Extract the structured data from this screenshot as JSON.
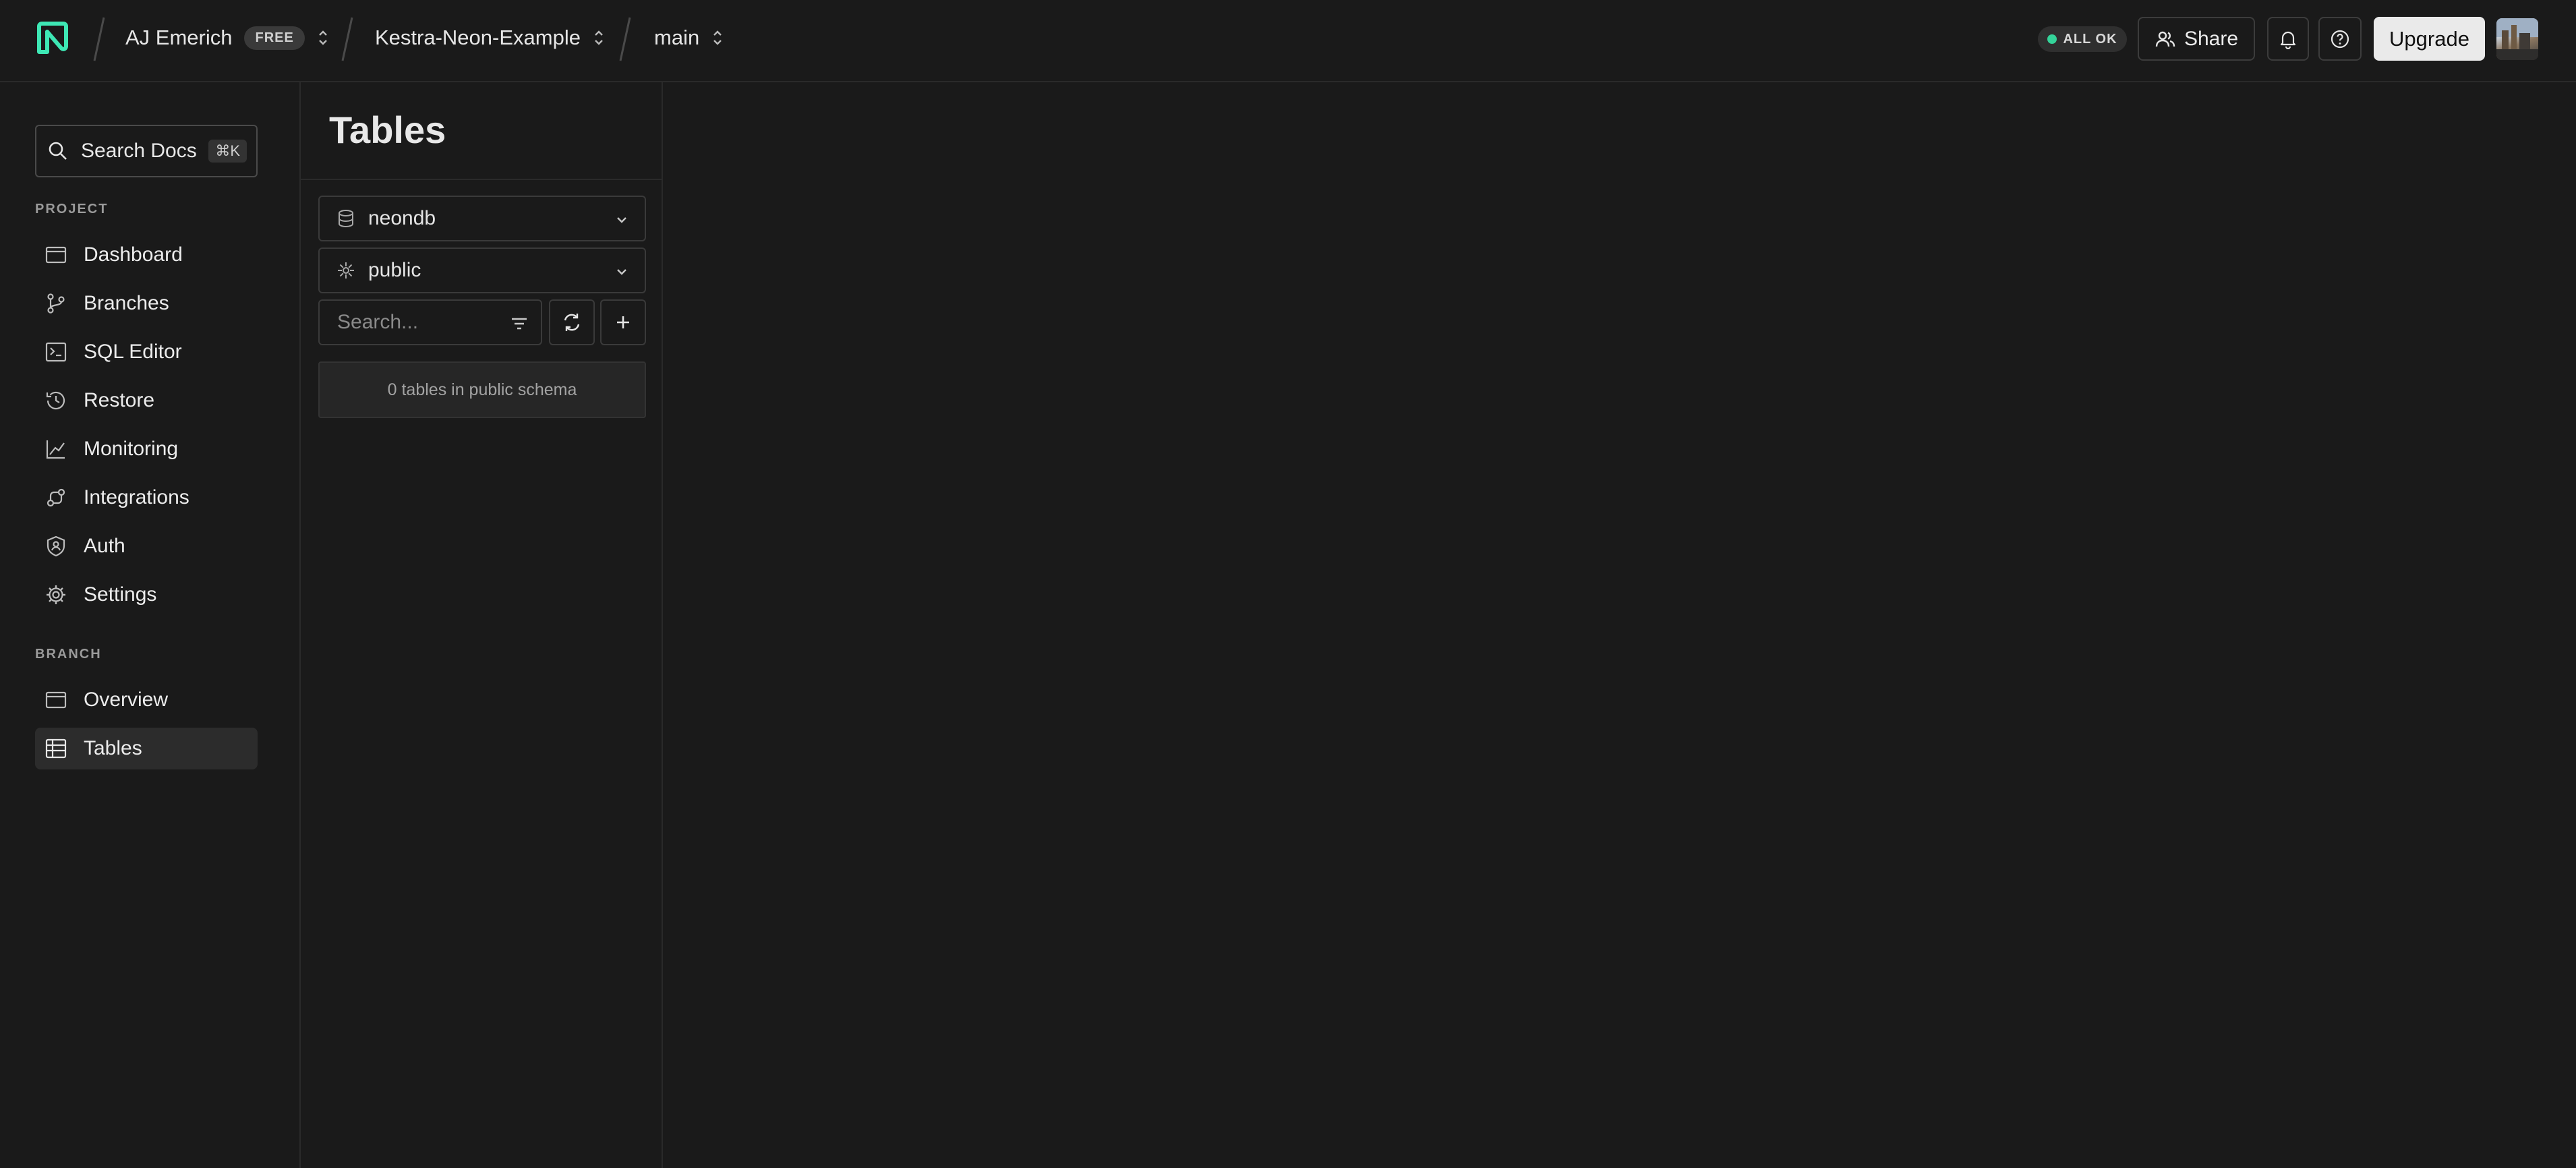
{
  "header": {
    "org_name": "AJ Emerich",
    "plan_badge": "FREE",
    "project_name": "Kestra-Neon-Example",
    "branch_name": "main",
    "status_label": "ALL OK",
    "share_label": "Share",
    "upgrade_label": "Upgrade"
  },
  "sidebar": {
    "search_label": "Search Docs",
    "search_shortcut": "⌘K",
    "project_section": "PROJECT",
    "project_items": [
      {
        "label": "Dashboard",
        "icon": "dashboard-icon"
      },
      {
        "label": "Branches",
        "icon": "branches-icon"
      },
      {
        "label": "SQL Editor",
        "icon": "sql-editor-icon"
      },
      {
        "label": "Restore",
        "icon": "restore-icon"
      },
      {
        "label": "Monitoring",
        "icon": "monitoring-icon"
      },
      {
        "label": "Integrations",
        "icon": "integrations-icon"
      },
      {
        "label": "Auth",
        "icon": "auth-icon"
      },
      {
        "label": "Settings",
        "icon": "gear-icon"
      }
    ],
    "branch_section": "BRANCH",
    "branch_items": [
      {
        "label": "Overview",
        "icon": "overview-icon"
      },
      {
        "label": "Tables",
        "icon": "tables-icon",
        "active": true
      }
    ]
  },
  "tables_panel": {
    "title": "Tables",
    "database": "neondb",
    "schema": "public",
    "search_placeholder": "Search...",
    "empty_message": "0 tables in public schema"
  },
  "colors": {
    "background": "#1a1a1a",
    "accent": "#34d399",
    "logo": "#3ee8b5"
  }
}
